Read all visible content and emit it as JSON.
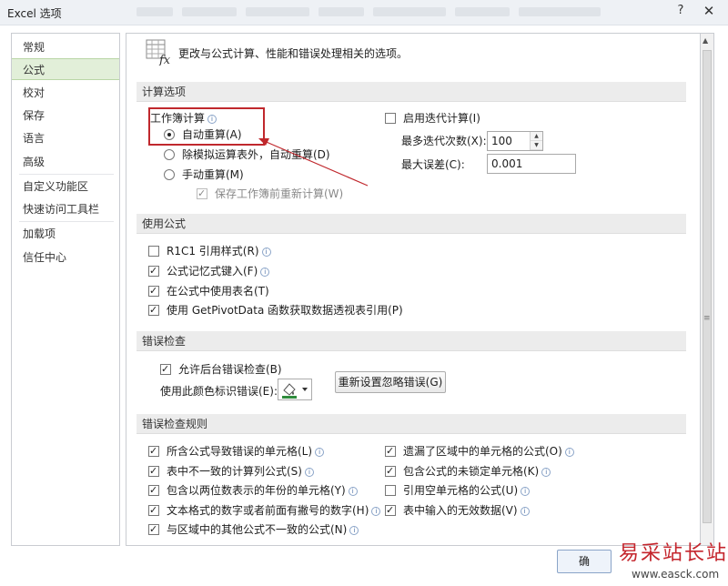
{
  "window": {
    "title": "Excel 选项",
    "help_glyph": "?",
    "close_glyph": "✕"
  },
  "sidebar": {
    "items": [
      {
        "label": "常规"
      },
      {
        "label": "公式"
      },
      {
        "label": "校对"
      },
      {
        "label": "保存"
      },
      {
        "label": "语言"
      },
      {
        "label": "高级"
      },
      {
        "label": "自定义功能区"
      },
      {
        "label": "快速访问工具栏"
      },
      {
        "label": "加载项"
      },
      {
        "label": "信任中心"
      }
    ],
    "active_index": 1
  },
  "header": {
    "description": "更改与公式计算、性能和错误处理相关的选项。"
  },
  "calc": {
    "section_title": "计算选项",
    "workbook_calc_label": "工作簿计算",
    "auto": "自动重算(A)",
    "auto_except_tables": "除模拟运算表外，自动重算(D)",
    "manual": "手动重算(M)",
    "recalc_before_save": "保存工作簿前重新计算(W)",
    "iterative": "启用迭代计算(I)",
    "max_iter_label": "最多迭代次数(X):",
    "max_iter_value": "100",
    "max_change_label": "最大误差(C):",
    "max_change_value": "0.001"
  },
  "formulas": {
    "section_title": "使用公式",
    "r1c1": "R1C1 引用样式(R)",
    "autocomplete": "公式记忆式键入(F)",
    "table_names": "在公式中使用表名(T)",
    "getpivotdata": "使用 GetPivotData 函数获取数据透视表引用(P)"
  },
  "error_check": {
    "section_title": "错误检查",
    "background": "允许后台错误检查(B)",
    "color_label": "使用此颜色标识错误(E):",
    "reset_button": "重新设置忽略错误(G)",
    "color_accent": "#2e8b3c"
  },
  "rules": {
    "section_title": "错误检查规则",
    "left": [
      {
        "label": "所含公式导致错误的单元格(L)",
        "checked": true
      },
      {
        "label": "表中不一致的计算列公式(S)",
        "checked": true
      },
      {
        "label": "包含以两位数表示的年份的单元格(Y)",
        "checked": true
      },
      {
        "label": "文本格式的数字或者前面有撇号的数字(H)",
        "checked": true
      },
      {
        "label": "与区域中的其他公式不一致的公式(N)",
        "checked": true
      }
    ],
    "right": [
      {
        "label": "遗漏了区域中的单元格的公式(O)",
        "checked": true
      },
      {
        "label": "包含公式的未锁定单元格(K)",
        "checked": true
      },
      {
        "label": "引用空单元格的公式(U)",
        "checked": false
      },
      {
        "label": "表中输入的无效数据(V)",
        "checked": true
      }
    ]
  },
  "footer": {
    "ok_button_partial": "确"
  },
  "watermark": {
    "brand": "易采站长站",
    "url": "www.easck.com"
  },
  "colors": {
    "highlight_box": "#c0282d",
    "nav_active_bg": "#e2efd9"
  }
}
